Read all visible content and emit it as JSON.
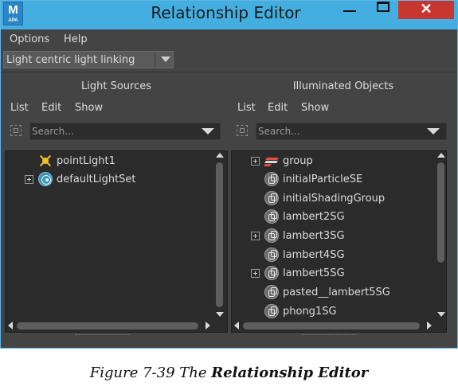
{
  "window": {
    "title": "Relationship Editor",
    "app_icon_letter": "M",
    "app_icon_sub": "APA",
    "close_glyph": "✕"
  },
  "menubar": {
    "items": [
      "Options",
      "Help"
    ]
  },
  "mode_dropdown": {
    "value": "Light centric light linking"
  },
  "left_panel": {
    "title": "Light Sources",
    "menu": [
      "List",
      "Edit",
      "Show"
    ],
    "search_placeholder": "Search...",
    "items": [
      {
        "label": "pointLight1",
        "icon": "point-light-icon",
        "expandable": false
      },
      {
        "label": "defaultLightSet",
        "icon": "light-set-icon",
        "expandable": true
      }
    ]
  },
  "right_panel": {
    "title": "Illuminated Objects",
    "menu": [
      "List",
      "Edit",
      "Show"
    ],
    "search_placeholder": "Search...",
    "items": [
      {
        "label": "group",
        "icon": "group-icon",
        "expandable": true
      },
      {
        "label": "initialParticleSE",
        "icon": "shading-group-icon",
        "expandable": false
      },
      {
        "label": "initialShadingGroup",
        "icon": "shading-group-icon",
        "expandable": false
      },
      {
        "label": "lambert2SG",
        "icon": "shading-group-icon",
        "expandable": false
      },
      {
        "label": "lambert3SG",
        "icon": "shading-group-icon",
        "expandable": true
      },
      {
        "label": "lambert4SG",
        "icon": "shading-group-icon",
        "expandable": false
      },
      {
        "label": "lambert5SG",
        "icon": "shading-group-icon",
        "expandable": true
      },
      {
        "label": "pasted__lambert5SG",
        "icon": "shading-group-icon",
        "expandable": false
      },
      {
        "label": "phong1SG",
        "icon": "shading-group-icon",
        "expandable": false
      }
    ]
  },
  "caption": {
    "prefix": "Figure 7-39  The ",
    "bold": "Relationship Editor"
  },
  "colors": {
    "titlebar": "#44aee0",
    "window_bg": "#444444",
    "list_bg": "#2b2b2b",
    "close_button": "#c7372f"
  }
}
